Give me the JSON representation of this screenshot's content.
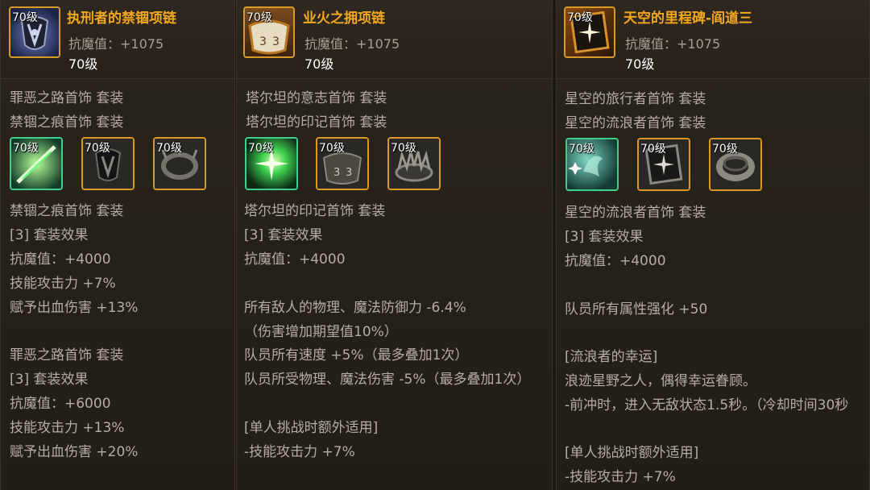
{
  "panels": [
    {
      "title": "执刑者的禁锢项链",
      "level_tag": "70级",
      "stat": "抗魔值：+1075",
      "level": "70级",
      "icon": "dark-claw-necklace-icon",
      "lines_top": [
        "罪恶之路首饰 套装",
        "禁锢之痕首饰 套装"
      ],
      "slots": [
        {
          "tag": "70级",
          "icon": "green-blade-ring-icon",
          "border": "#3fcf8a"
        },
        {
          "tag": "70级",
          "icon": "dark-claw-necklace-icon",
          "border": "#d89a22"
        },
        {
          "tag": "70级",
          "icon": "dark-spiked-ring-icon",
          "border": "#d89a22"
        }
      ],
      "lines_bottom": [
        "禁锢之痕首饰 套装",
        "[3] 套装效果",
        "抗魔值：+4000",
        "技能攻击力 +7%",
        "赋予出血伤害 +13%",
        "",
        "罪恶之路首饰 套装",
        "[3] 套装效果",
        "抗魔值：+6000",
        "技能攻击力 +13%",
        "赋予出血伤害 +20%"
      ]
    },
    {
      "title": "业火之拥项链",
      "level_tag": "70级",
      "stat": "抗魔值：+1075",
      "level": "70级",
      "icon": "runed-collar-necklace-icon",
      "lines_top": [
        "塔尔坦的意志首饰 套装",
        "塔尔坦的印记首饰 套装"
      ],
      "slots": [
        {
          "tag": "70级",
          "icon": "green-spark-ring-icon",
          "border": "#3fcf8a"
        },
        {
          "tag": "70级",
          "icon": "runed-collar-necklace-icon",
          "border": "#d89a22"
        },
        {
          "tag": "70级",
          "icon": "spiked-crown-bracelet-icon",
          "border": "#d89a22"
        }
      ],
      "lines_bottom": [
        "塔尔坦的印记首饰 套装",
        "[3] 套装效果",
        "抗魔值：+4000",
        "",
        "所有敌人的物理、魔法防御力 -6.4%",
        "（伤害增加期望值10%）",
        "队员所有速度 +5%（最多叠加1次）",
        "队员所受物理、魔法伤害 -5%（最多叠加1次）",
        "",
        "[单人挑战时额外适用]",
        "-技能攻击力 +7%"
      ]
    },
    {
      "title": "天空的里程碑-阎道三",
      "level_tag": "70级",
      "stat": "抗魔值：+1075",
      "level": "70级",
      "icon": "star-tablet-icon",
      "lines_top": [
        "星空的旅行者首饰 套装",
        "星空的流浪者首饰 套装"
      ],
      "slots": [
        {
          "tag": "70级",
          "icon": "teal-star-charm-icon",
          "border": "#3fcf8a"
        },
        {
          "tag": "70级",
          "icon": "star-tablet-icon",
          "border": "#d89a22"
        },
        {
          "tag": "70级",
          "icon": "metal-band-ring-icon",
          "border": "#d89a22"
        }
      ],
      "lines_bottom": [
        "星空的流浪者首饰 套装",
        "[3] 套装效果",
        "抗魔值：+4000",
        "",
        "队员所有属性强化 +50",
        "",
        "[流浪者的幸运]",
        "浪迹星野之人，偶得幸运眷顾。",
        "-前冲时，进入无敌状态1.5秒。（冷却时间30秒",
        "",
        "[单人挑战时额外适用]",
        "-技能攻击力 +7%"
      ]
    }
  ]
}
